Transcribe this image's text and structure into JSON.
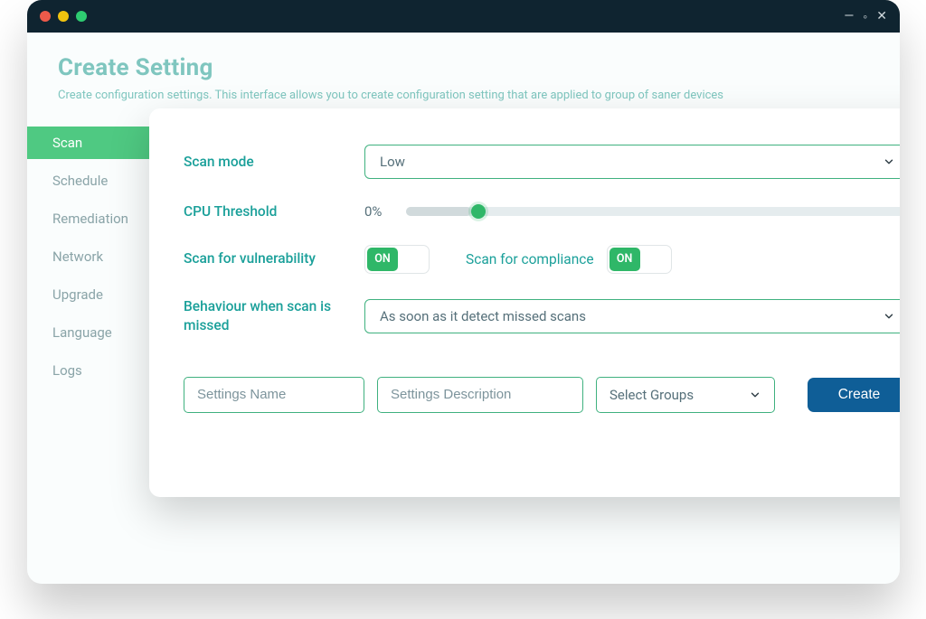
{
  "window_controls": {
    "minimize": "—",
    "maximize": "◦",
    "close": "✕"
  },
  "page": {
    "title": "Create Setting",
    "description": "Create configuration settings. This interface allows you to create configuration setting that are applied to group of saner devices"
  },
  "sidebar": {
    "items": [
      {
        "label": "Scan",
        "active": true
      },
      {
        "label": "Schedule",
        "active": false
      },
      {
        "label": "Remediation",
        "active": false
      },
      {
        "label": "Network",
        "active": false
      },
      {
        "label": "Upgrade",
        "active": false
      },
      {
        "label": "Language",
        "active": false
      },
      {
        "label": "Logs",
        "active": false
      }
    ]
  },
  "form": {
    "scan_mode": {
      "label": "Scan mode",
      "value": "Low"
    },
    "cpu_threshold": {
      "label": "CPU Threshold",
      "value_text": "0%"
    },
    "scan_vuln": {
      "label": "Scan for vulnerability",
      "state": "ON"
    },
    "scan_comp": {
      "label": "Scan for compliance",
      "state": "ON"
    },
    "missed": {
      "label": "Behaviour when scan is missed",
      "value": "As soon as it detect missed scans"
    },
    "settings_name_placeholder": "Settings Name",
    "settings_desc_placeholder": "Settings Description",
    "select_groups_label": "Select Groups",
    "create_label": "Create"
  }
}
